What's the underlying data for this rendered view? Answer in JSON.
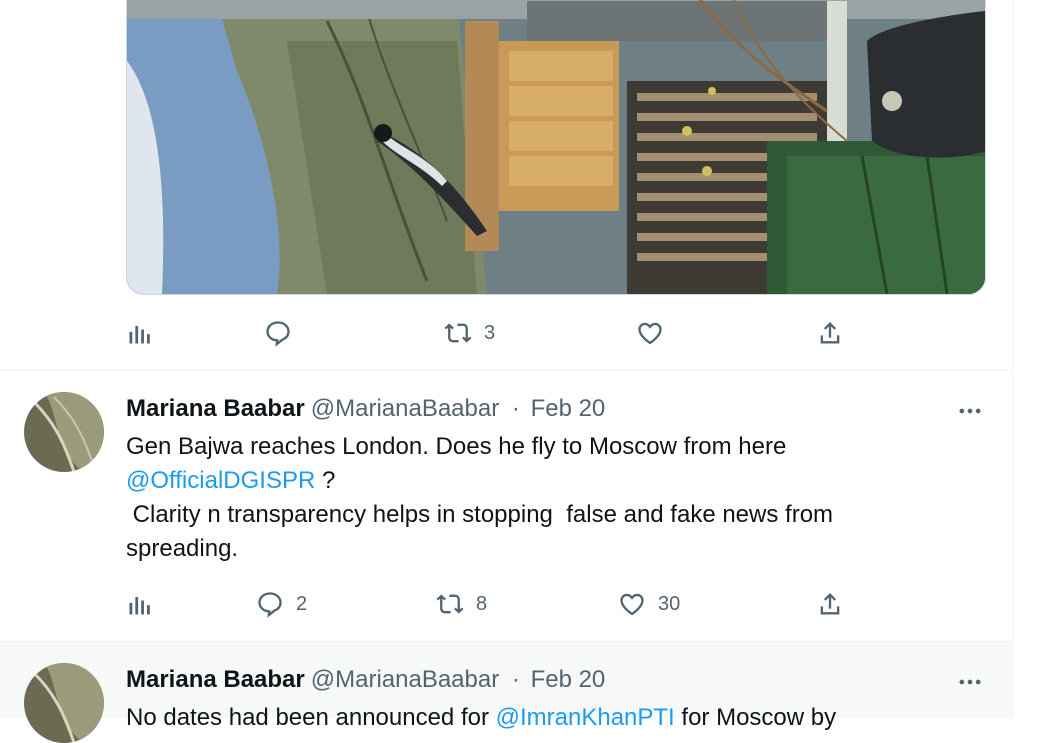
{
  "media": {
    "alt": "Bird perched on fence near wooden structure, photo rotated"
  },
  "first_tweet_actions": {
    "views": "",
    "replies": "",
    "retweets": "3",
    "likes": ""
  },
  "tweets": [
    {
      "name": "Mariana Baabar",
      "handle": "@MarianaBaabar",
      "sep": "·",
      "date": "Feb 20",
      "text_1": "Gen Bajwa reaches London. Does he fly to Moscow from here",
      "mention": "@OfficialDGISPR",
      "text_2": " ?",
      "text_3": " Clarity n transparency helps in stopping  false and fake news from\nspreading.",
      "replies": "2",
      "retweets": "8",
      "likes": "30"
    },
    {
      "name": "Mariana Baabar",
      "handle": "@MarianaBaabar",
      "sep": "·",
      "date": "Feb 20",
      "text_1": "No dates had been announced for ",
      "mention": "@ImranKhanPTI",
      "text_2": " for Moscow by"
    }
  ]
}
